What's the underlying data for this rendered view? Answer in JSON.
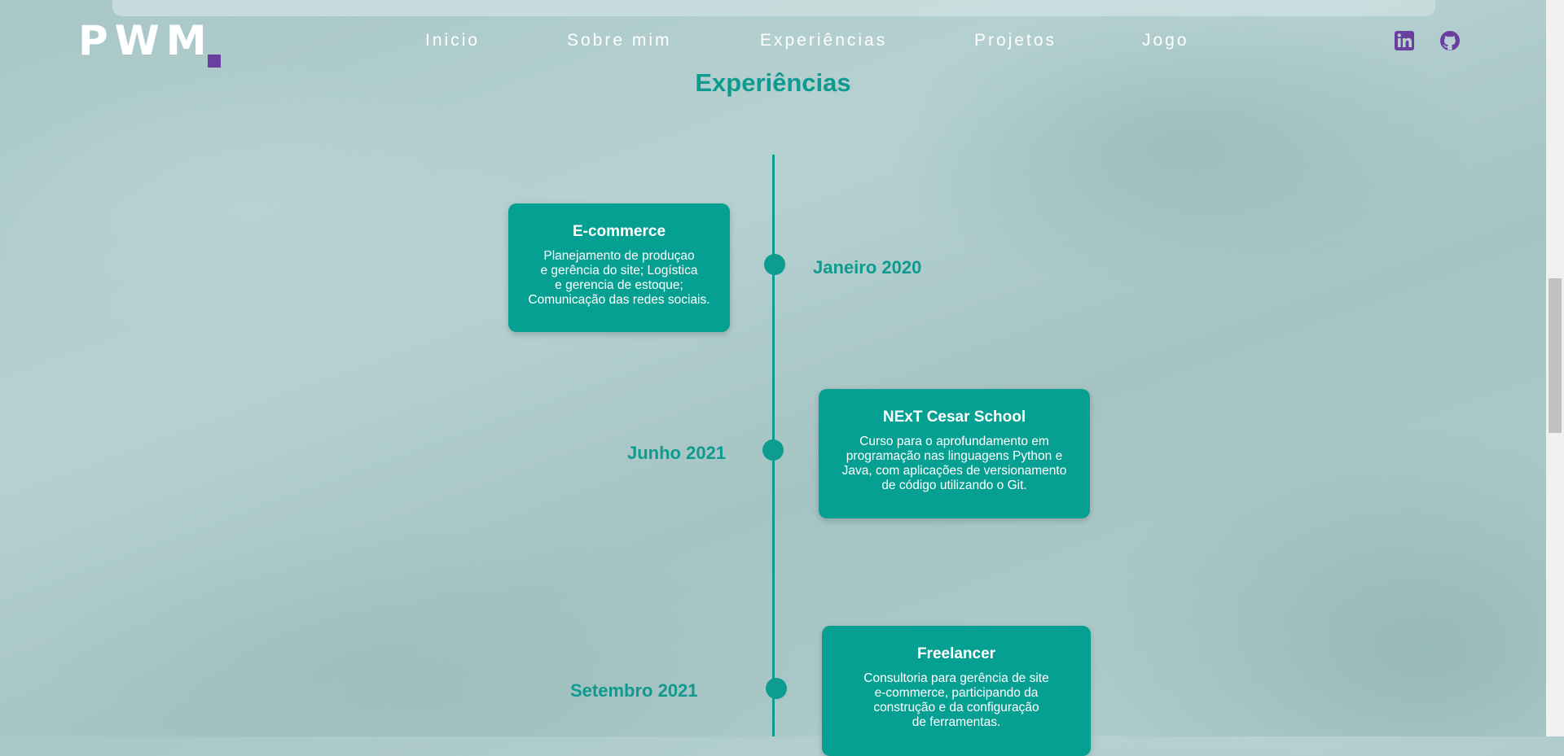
{
  "header": {
    "logo_text": "PWM",
    "logo_dot_color": "#6b3fa0",
    "nav": [
      {
        "label": "Inicio"
      },
      {
        "label": "Sobre mim"
      },
      {
        "label": "Experiências"
      },
      {
        "label": "Projetos"
      },
      {
        "label": "Jogo"
      }
    ],
    "social": [
      {
        "icon": "linkedin-icon"
      },
      {
        "icon": "github-icon"
      }
    ]
  },
  "section": {
    "title": "Experiências"
  },
  "timeline": [
    {
      "date": "Janeiro 2020",
      "title": "E-commerce",
      "description_lines": [
        "Planejamento de produçao",
        "e gerência do site; Logística",
        "e gerencia de estoque;",
        "Comunicação das redes sociais."
      ]
    },
    {
      "date": "Junho 2021",
      "title": "NExT Cesar School",
      "description_lines": [
        "Curso para o aprofundamento em",
        "programação nas linguagens Python e",
        "Java, com aplicações de versionamento",
        "de código utilizando o Git."
      ]
    },
    {
      "date": "Setembro 2021",
      "title": "Freelancer",
      "description_lines": [
        "Consultoria para gerência de site",
        "e-commerce, participando da",
        "construção e da configuração",
        "de ferramentas."
      ]
    }
  ],
  "colors": {
    "accent": "#0e9c90",
    "card": "#06a092",
    "icon": "#6b3fa0"
  }
}
